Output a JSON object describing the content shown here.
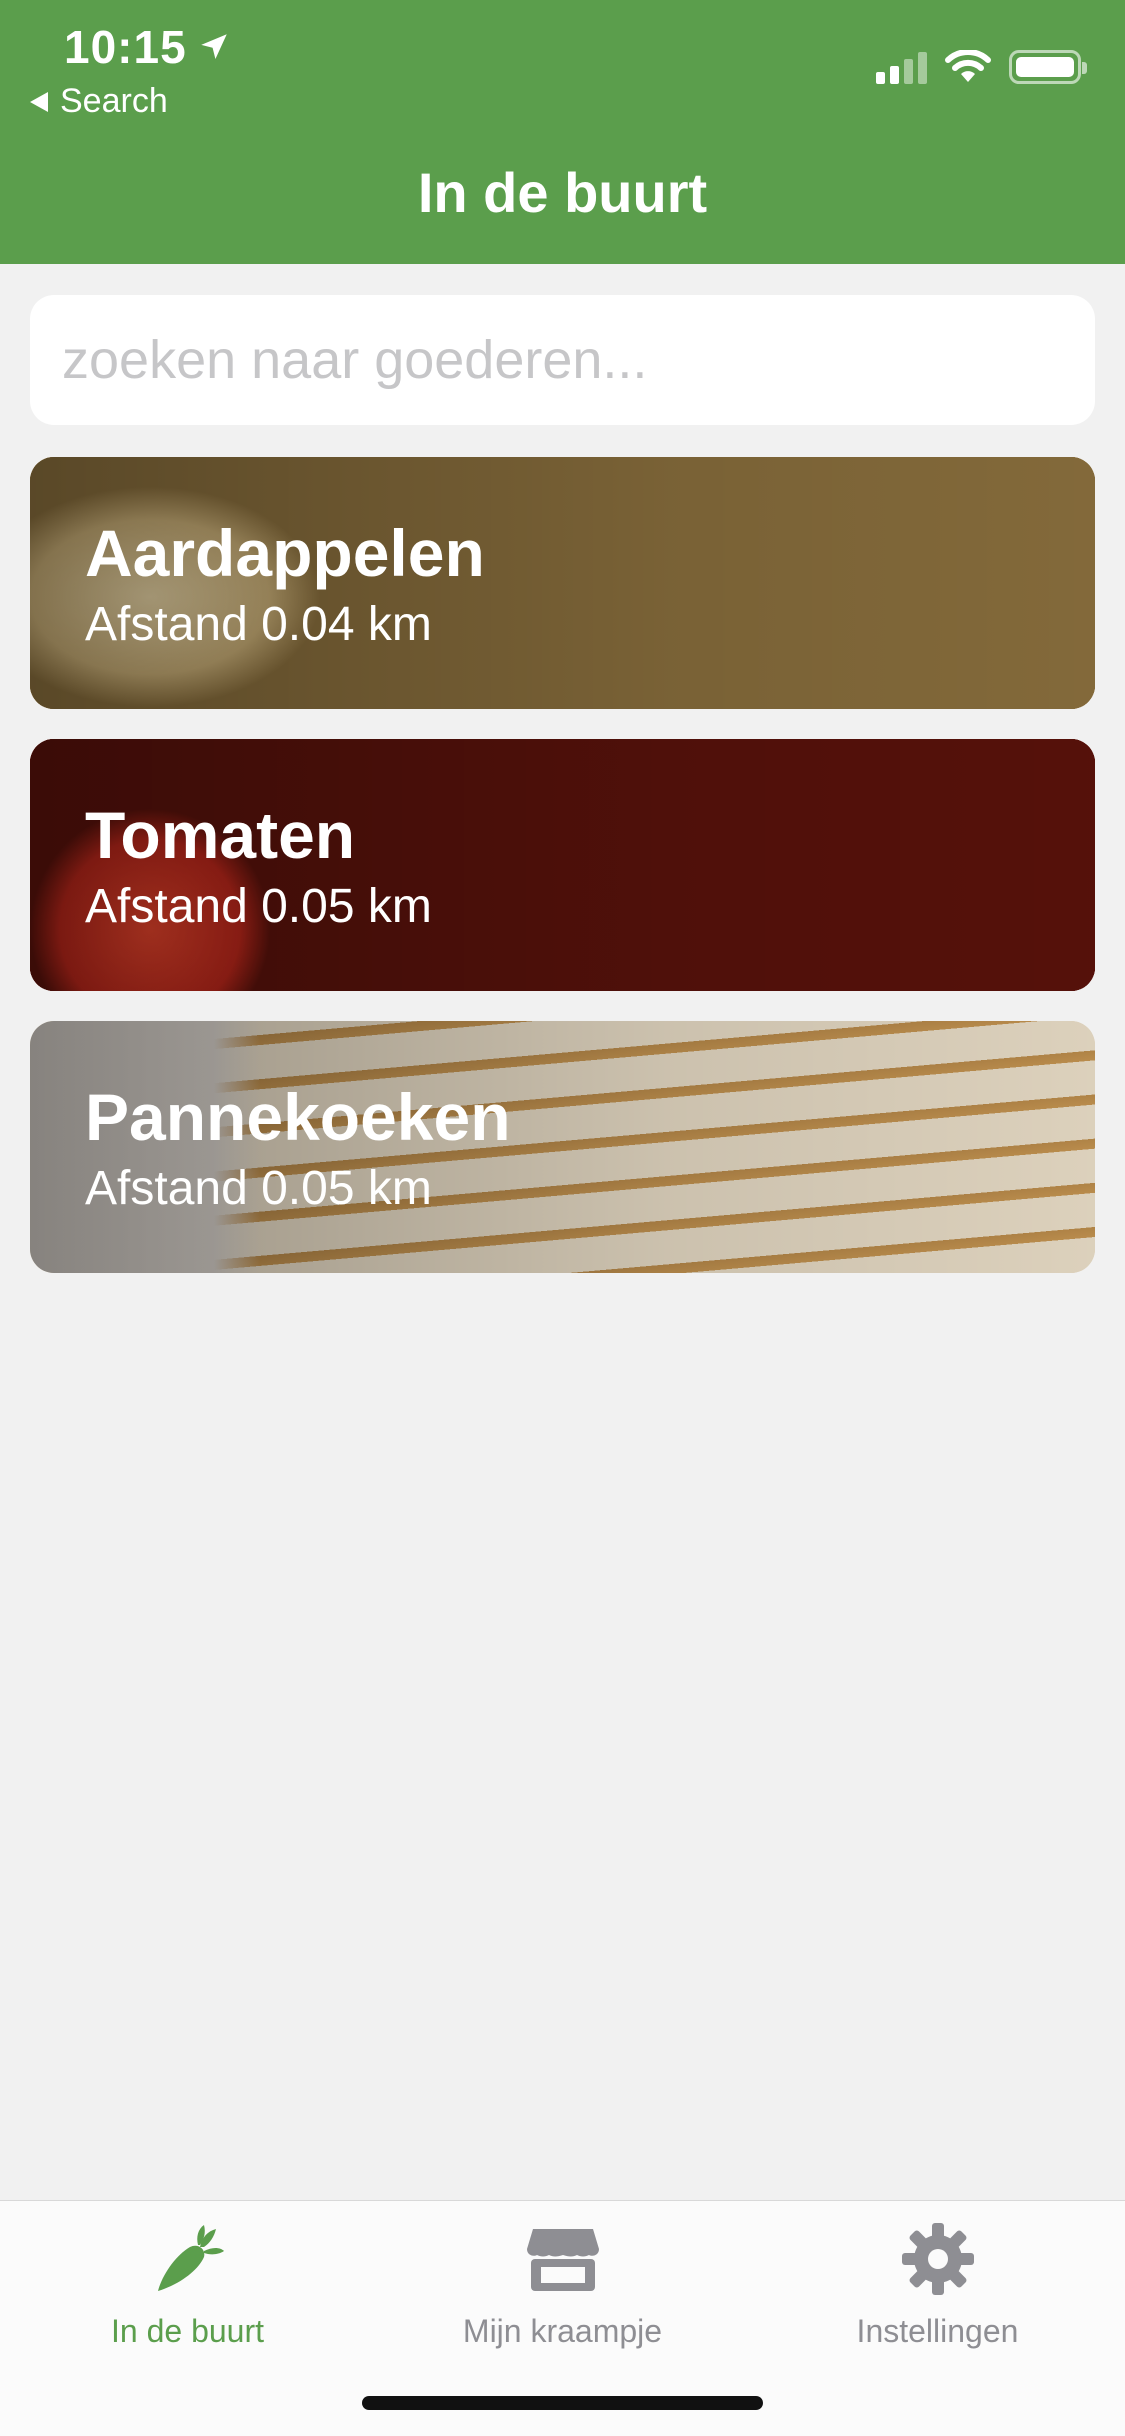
{
  "status_bar": {
    "time": "10:15",
    "back_label": "Search"
  },
  "header": {
    "title": "In de buurt",
    "color": "#5b9e4c"
  },
  "search": {
    "placeholder": "zoeken naar goederen...",
    "value": ""
  },
  "items": [
    {
      "name": "Aardappelen",
      "distance": "Afstand 0.04 km",
      "image": "potatoes"
    },
    {
      "name": "Tomaten",
      "distance": "Afstand 0.05 km",
      "image": "tomatoes"
    },
    {
      "name": "Pannekoeken",
      "distance": "Afstand 0.05 km",
      "image": "pancakes"
    }
  ],
  "tabbar": {
    "tabs": [
      {
        "label": "In de buurt",
        "icon": "carrot-icon",
        "active": true
      },
      {
        "label": "Mijn kraampje",
        "icon": "store-icon",
        "active": false
      },
      {
        "label": "Instellingen",
        "icon": "gear-icon",
        "active": false
      }
    ],
    "active_color": "#5b9e4c",
    "inactive_color": "#8e8e93"
  }
}
